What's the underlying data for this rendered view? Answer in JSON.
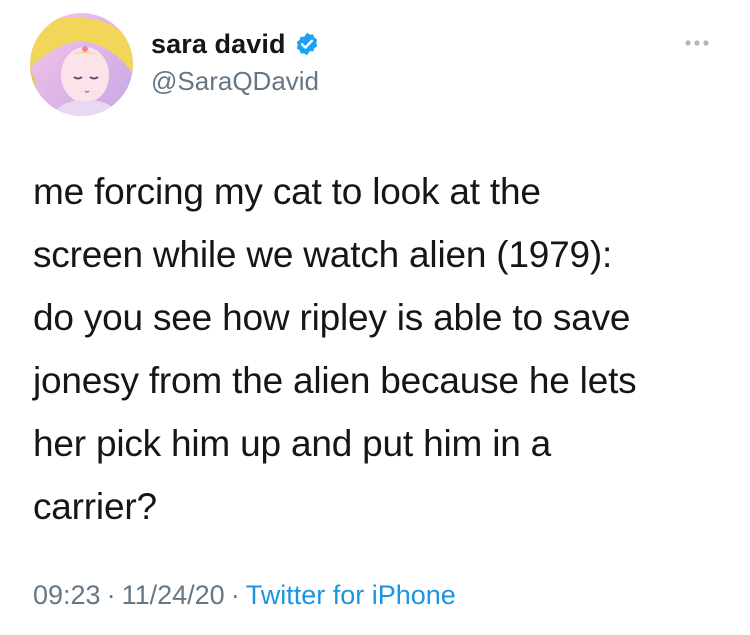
{
  "author": {
    "display_name": "sara david",
    "handle": "@SaraQDavid",
    "verified": true,
    "avatar_icon": "anime-girl-avatar"
  },
  "tweet": {
    "lines": [
      "me forcing my cat to look at the",
      "screen while we watch alien (1979):",
      "do you see how ripley is able to save",
      "jonesy from the alien because he lets",
      "her pick him up and put him in a",
      "carrier?"
    ]
  },
  "meta": {
    "time": "09:23",
    "separator": "·",
    "date": "11/24/20",
    "source": "Twitter for iPhone"
  },
  "colors": {
    "text": "#14171a",
    "secondary": "#657786",
    "link": "#1b95e0",
    "verified": "#1da1f2"
  }
}
